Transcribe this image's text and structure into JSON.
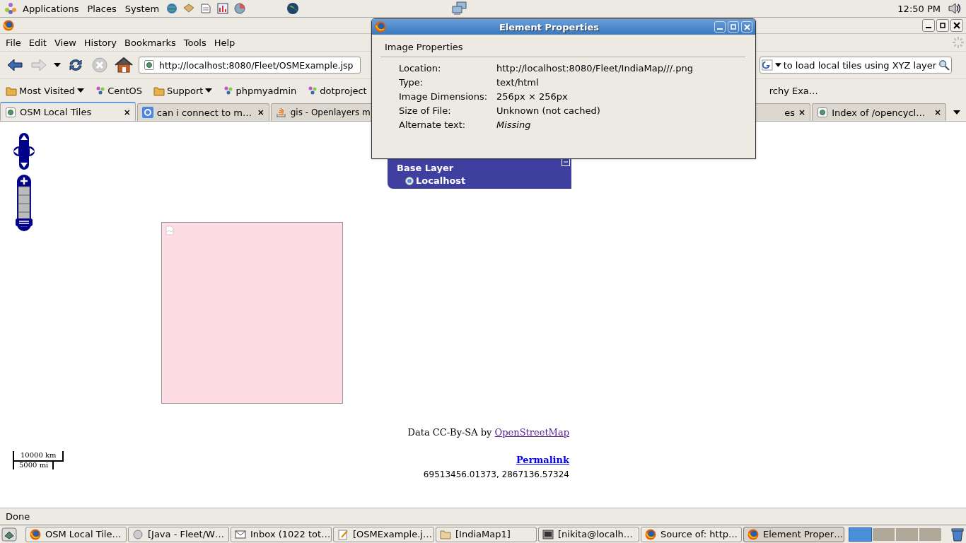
{
  "top_panel": {
    "menus": [
      "Applications",
      "Places",
      "System"
    ],
    "clock": "12:50 PM"
  },
  "browser": {
    "menus": [
      "File",
      "Edit",
      "View",
      "History",
      "Bookmarks",
      "Tools",
      "Help"
    ],
    "url": "http://localhost:8080/Fleet/OSMExample.jsp",
    "search": "to load local tiles using XYZ layer",
    "bookmarks": [
      {
        "label": "Most Visited",
        "kind": "menu"
      },
      {
        "label": "CentOS",
        "kind": "link"
      },
      {
        "label": "Support",
        "kind": "menu"
      },
      {
        "label": "phpmyadmin",
        "kind": "link"
      },
      {
        "label": "dotproject",
        "kind": "link"
      },
      {
        "kind": "icon"
      },
      {
        "label": "rchy Exa…",
        "kind": "partial"
      }
    ],
    "tabs": [
      {
        "label": "OSM Local Tiles",
        "selected": true,
        "close": "×"
      },
      {
        "label": "can i connect to m…",
        "selected": false,
        "close": "×"
      },
      {
        "label": "gis - Openlayers m",
        "selected": false
      },
      {
        "label": "es",
        "selected": false,
        "close": "×"
      },
      {
        "label": "Index of /opencycl…",
        "selected": false,
        "close": "×"
      }
    ],
    "status": "Done"
  },
  "map": {
    "zoom_slider": {
      "level": 0
    },
    "layer_switcher": {
      "heading": "Base Layer",
      "layers": [
        {
          "label": "Localhost",
          "selected": true
        }
      ]
    },
    "attribution": {
      "text": "Data CC-By-SA by ",
      "link": "OpenStreetMap"
    },
    "scale": {
      "top": "10000 km",
      "bottom": "5000 mi"
    },
    "permalink": "Permalink",
    "coordinates": "69513456.01373, 2867136.57324"
  },
  "dialog": {
    "title": "Element Properties",
    "section": "Image Properties",
    "rows": [
      {
        "label": "Location:",
        "value": "http://localhost:8080/Fleet/IndiaMap///.png",
        "kind": "plain"
      },
      {
        "label": "Type:",
        "value": "text/html",
        "kind": "plain"
      },
      {
        "label": "Image Dimensions:",
        "value": "256px × 256px",
        "kind": "plain"
      },
      {
        "label": "Size of File:",
        "value": "Unknown (not cached)",
        "kind": "plain"
      },
      {
        "label": "Alternate text:",
        "value": "Missing",
        "kind": "missing"
      }
    ]
  },
  "taskbar": {
    "tasks": [
      {
        "label": "OSM Local Tile…",
        "selected": false
      },
      {
        "label": "[Java - Fleet/W…",
        "selected": false
      },
      {
        "label": "Inbox (1022 tot…",
        "selected": false
      },
      {
        "label": "[OSMExample.j…",
        "selected": false
      },
      {
        "label": "[IndiaMap1]",
        "selected": false
      },
      {
        "label": "[nikita@localh…",
        "selected": false
      },
      {
        "label": "Source of: http…",
        "selected": false
      },
      {
        "label": "Element Proper…",
        "selected": true
      }
    ],
    "workspaces": [
      {
        "selected": true
      },
      {
        "selected": false
      },
      {
        "selected": false
      },
      {
        "selected": false
      }
    ]
  }
}
